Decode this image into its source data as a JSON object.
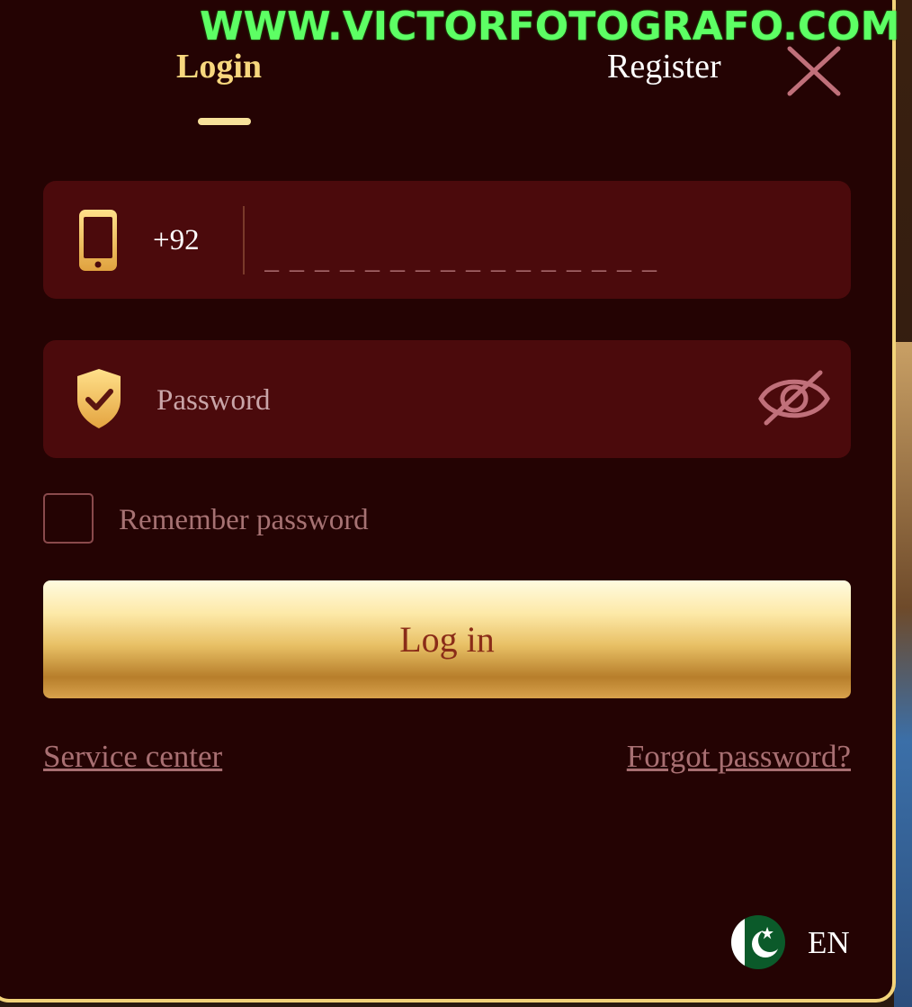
{
  "watermark": "WWW.VICTORFOTOGRAFO.COM",
  "tabs": {
    "login": "Login",
    "register": "Register",
    "active": "Login"
  },
  "phone": {
    "country_code": "+92",
    "placeholder": "_ _ _ _ _ _ _ _ _ _ _ _ _ _ _ _",
    "value": ""
  },
  "password": {
    "placeholder": "Password",
    "value": ""
  },
  "remember": {
    "label": "Remember password",
    "checked": false
  },
  "login_button": "Log in",
  "links": {
    "service": "Service center",
    "forgot": "Forgot password?"
  },
  "language": {
    "code": "EN",
    "flag": "pakistan-flag-icon"
  },
  "colors": {
    "panel_bg": "#240303",
    "field_bg": "#4b0a0c",
    "accent_gold": "#f7d77e",
    "border_gold": "#f2d37a",
    "muted_text": "#a67273",
    "watermark": "#5dff64"
  }
}
